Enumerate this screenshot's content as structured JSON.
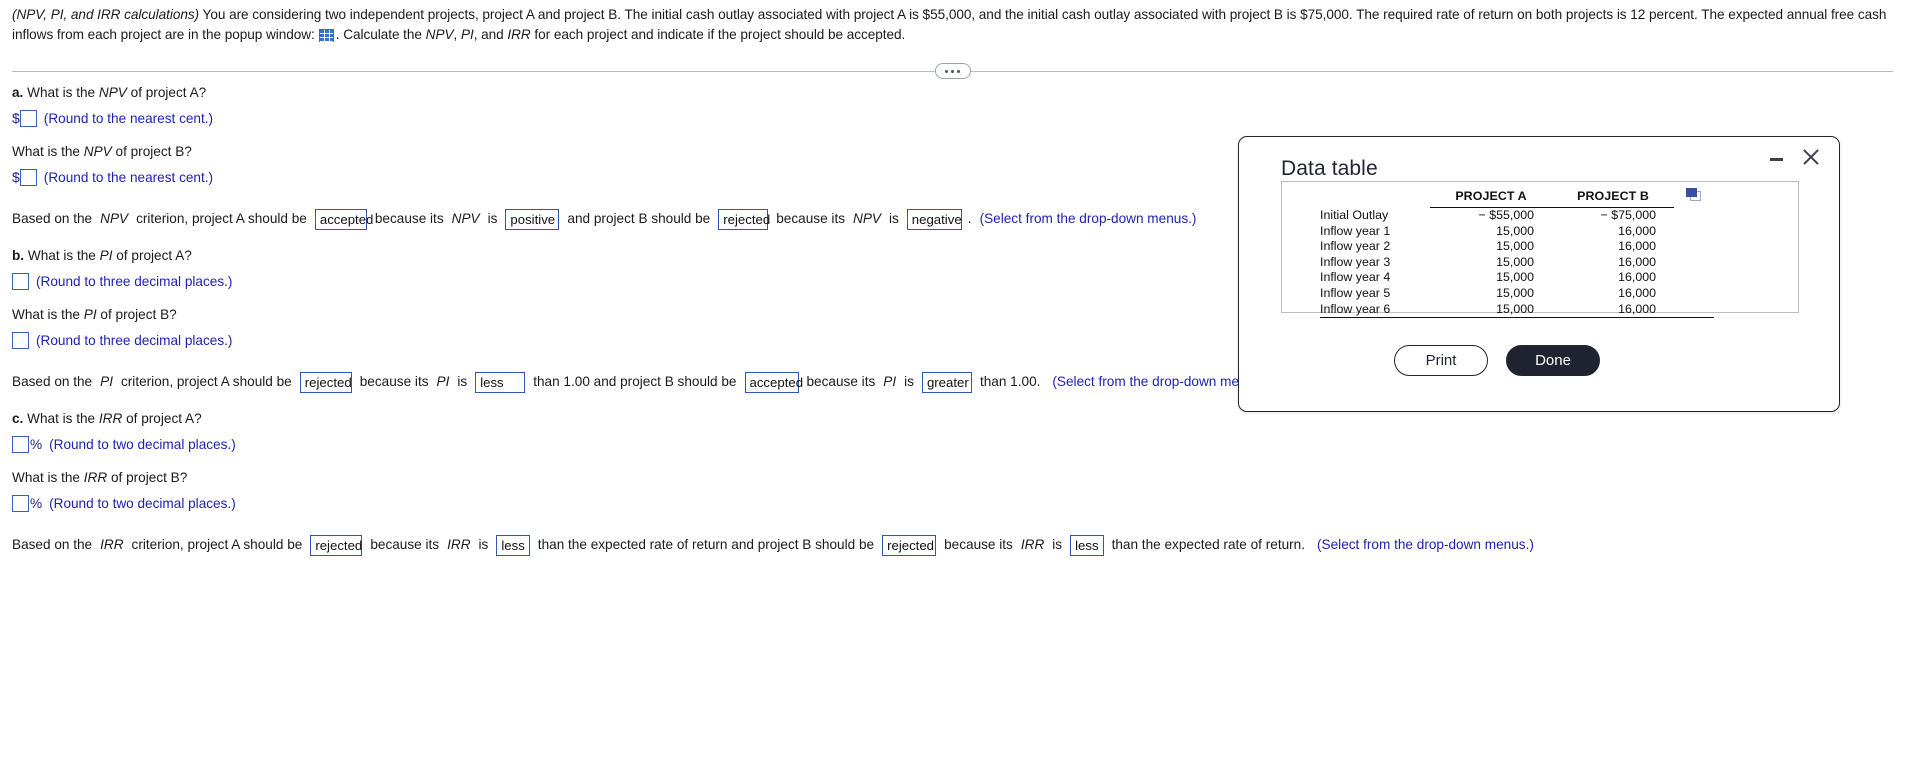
{
  "problem": {
    "title_italic": "(NPV, PI, and IRR calculations)",
    "text_part1": " You are considering two independent projects, project A and project B. The initial cash outlay associated with project A is $55,000, and the initial cash outlay associated with project B is $75,000. The required rate of return on both projects is 12 percent. The expected annual free cash inflows from each project are in the popup window:",
    "icon": "grid-table-icon",
    "text_part2": ". Calculate the ",
    "abbr_npv": "NPV",
    "sep1": ", ",
    "abbr_pi": "PI",
    "sep2": ", and ",
    "abbr_irr": "IRR",
    "text_part3": " for each project and indicate if the project should be accepted."
  },
  "divider": {
    "dots": "•••"
  },
  "parts": {
    "a": {
      "marker": "a.",
      "question_a": " What is the ",
      "abbr": "NPV",
      "question_a_tail": " of project A?",
      "currency": "$",
      "hint": "(Round to the nearest cent.)",
      "question_b_lead": "What is the ",
      "question_b_tail": " of project B?",
      "hint_b": "(Round to the nearest cent.)"
    },
    "b": {
      "marker": "b.",
      "question_a": " What is the ",
      "abbr": "PI",
      "question_a_tail": " of project A?",
      "hint": "(Round to three decimal places.)",
      "question_b_lead": "What is the ",
      "question_b_tail": " of project B?",
      "hint_b": "(Round to three decimal places.)"
    },
    "c": {
      "marker": "c.",
      "question_a": " What is the ",
      "abbr": "IRR",
      "question_a_tail": " of project A?",
      "percent": "%",
      "hint": "(Round to two decimal places.)",
      "question_b_lead": "What is the ",
      "question_b_tail": " of project B?",
      "percent_b": "%",
      "hint_b": "(Round to two decimal places.)"
    }
  },
  "criteria": {
    "npv": {
      "lead": "Based on the",
      "abbr": "NPV",
      "lead2": "criterion, project A should be",
      "dd1": "accepted",
      "mid1": "because its",
      "abbr2": "NPV",
      "mid1b": "is",
      "dd2": "positive",
      "mid2": "and project B should be",
      "dd3": "rejected",
      "mid3": "because its",
      "abbr3": "NPV",
      "mid3b": "is",
      "dd4": "negative",
      "period": ".",
      "hint": "(Select from the drop-down menus.)"
    },
    "pi": {
      "lead": "Based on the",
      "abbr": "PI",
      "lead2": "criterion, project A should be",
      "dd1": "rejected",
      "mid1": "because its",
      "abbr2": "PI",
      "mid1b": "is",
      "dd2": "less",
      "mid2": "than 1.00 and project B should be",
      "dd3": "accepted",
      "mid3": "because its",
      "abbr3": "PI",
      "mid3b": "is",
      "dd4": "greater",
      "mid4": "than 1.00.",
      "hint": "(Select from the drop-down menus.)"
    },
    "irr": {
      "lead": "Based on the",
      "abbr": "IRR",
      "lead2": "criterion, project A should be",
      "dd1": "rejected",
      "mid1": "because its",
      "abbr2": "IRR",
      "mid1b": "is",
      "dd2": "less",
      "mid2": "than the expected rate of return and project B should be",
      "dd3": "rejected",
      "mid3": "because its",
      "abbr3": "IRR",
      "mid3b": "is",
      "dd4": "less",
      "mid4": "than the expected rate of return.",
      "hint": "(Select from the drop-down menus.)"
    }
  },
  "dialog": {
    "title": "Data table",
    "minimize_icon": "minimize-icon",
    "close_icon": "close-icon",
    "copy_icon": "copy-icon",
    "print_label": "Print",
    "done_label": "Done",
    "table": {
      "columns": [
        "",
        "PROJECT A",
        "PROJECT B"
      ],
      "rows": [
        {
          "label": "Initial Outlay",
          "a": "− $55,000",
          "b": "− $75,000"
        },
        {
          "label": "Inflow year 1",
          "a": "15,000",
          "b": "16,000"
        },
        {
          "label": "Inflow year 2",
          "a": "15,000",
          "b": "16,000"
        },
        {
          "label": "Inflow year 3",
          "a": "15,000",
          "b": "16,000"
        },
        {
          "label": "Inflow year 4",
          "a": "15,000",
          "b": "16,000"
        },
        {
          "label": "Inflow year 5",
          "a": "15,000",
          "b": "16,000"
        },
        {
          "label": "Inflow year 6",
          "a": "15,000",
          "b": "16,000"
        }
      ]
    }
  }
}
